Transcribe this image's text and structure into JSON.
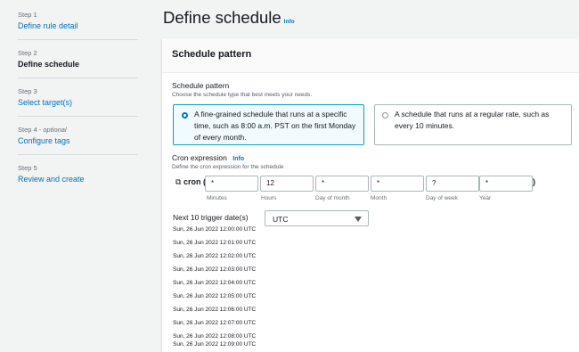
{
  "sidebar": {
    "steps": [
      {
        "number": "Step 1",
        "label": "Define rule detail",
        "active": false
      },
      {
        "number": "Step 2",
        "label": "Define schedule",
        "active": true
      },
      {
        "number": "Step 3",
        "label": "Select target(s)",
        "active": false
      },
      {
        "number": "Step 4",
        "optional": "optional",
        "label": "Configure tags",
        "active": false
      },
      {
        "number": "Step 5",
        "label": "Review and create",
        "active": false
      }
    ]
  },
  "page": {
    "title": "Define schedule",
    "info_link": "Info"
  },
  "panel": {
    "title": "Schedule pattern",
    "pattern_label": "Schedule pattern",
    "pattern_description": "Choose the schedule type that best meets your needs.",
    "options": [
      {
        "text": "A fine-grained schedule that runs at a specific time, such as 8:00 a.m. PST on the first Monday of every month.",
        "selected": true
      },
      {
        "text": "A schedule that runs at a regular rate, such as every 10 minutes.",
        "selected": false
      }
    ],
    "cron": {
      "label": "Cron expression",
      "info_link": "Info",
      "description": "Define the cron expression for the schedule",
      "prefix": "cron (",
      "suffix": ")",
      "fields": [
        {
          "value": "*",
          "caption": "Minutes"
        },
        {
          "value": "12",
          "caption": "Hours"
        },
        {
          "value": "*",
          "caption": "Day of month"
        },
        {
          "value": "*",
          "caption": "Month"
        },
        {
          "value": "?",
          "caption": "Day of week"
        },
        {
          "value": "*",
          "caption": "Year"
        }
      ]
    },
    "triggers": {
      "label": "Next 10 trigger date(s)",
      "timezone": "UTC",
      "dates": [
        "Sun, 26 Jun 2022 12:00:00 UTC",
        "Sun, 26 Jun 2022 12:01:00 UTC",
        "Sun, 26 Jun 2022 12:02:00 UTC",
        "Sun, 26 Jun 2022 12:03:00 UTC",
        "Sun, 26 Jun 2022 12:04:00 UTC",
        "Sun, 26 Jun 2022 12:05:00 UTC",
        "Sun, 26 Jun 2022 12:06:00 UTC",
        "Sun, 26 Jun 2022 12:07:00 UTC",
        "Sun, 26 Jun 2022 12:08:00 UTC",
        "Sun, 26 Jun 2022 12:09:00 UTC"
      ]
    }
  },
  "colors": {
    "link": "#0073bb",
    "selected_border": "#00a1c9",
    "selected_bg": "#f1faff"
  }
}
